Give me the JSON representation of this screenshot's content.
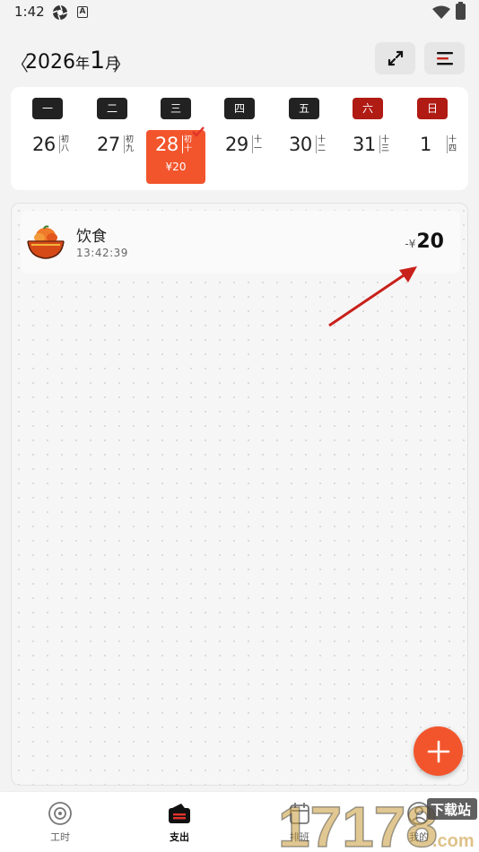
{
  "status_bar": {
    "time": "1:42",
    "icons": [
      "aperture-icon",
      "a-badge-icon",
      "wifi-icon",
      "battery-icon"
    ]
  },
  "header": {
    "prev_icon": "chevron-left-icon",
    "next_icon": "chevron-right-icon",
    "year": "2026",
    "year_unit": "年",
    "month": "1",
    "month_unit": "月",
    "actions": [
      "expand-icon",
      "sort-lines-icon"
    ]
  },
  "week": {
    "weekdays": [
      "一",
      "二",
      "三",
      "四",
      "五",
      "六",
      "日"
    ],
    "days": [
      {
        "num": "26",
        "lunar": "初八"
      },
      {
        "num": "27",
        "lunar": "初九"
      },
      {
        "num": "28",
        "lunar": "初十",
        "amount": "¥20",
        "selected": true
      },
      {
        "num": "29",
        "lunar": "十一"
      },
      {
        "num": "30",
        "lunar": "十二"
      },
      {
        "num": "31",
        "lunar": "十三"
      },
      {
        "num": "1",
        "lunar": "十四"
      }
    ]
  },
  "records": [
    {
      "icon": "food-bowl-icon",
      "category": "饮食",
      "time": "13:42:39",
      "prefix": "-¥",
      "value": "20"
    }
  ],
  "fab": {
    "icon": "plus-icon"
  },
  "bottom_nav": [
    {
      "label": "工时",
      "icon": "clock-target-icon",
      "active": false
    },
    {
      "label": "支出",
      "icon": "wallet-icon",
      "active": true
    },
    {
      "label": "排班",
      "icon": "calendar-icon",
      "active": false
    },
    {
      "label": "我的",
      "icon": "user-icon",
      "active": false
    }
  ],
  "watermark": {
    "text": "17178",
    "site": "下载站",
    "domain": ".com"
  },
  "colors": {
    "accent": "#f2552c",
    "weekend": "#b01b14",
    "dark": "#222222"
  }
}
